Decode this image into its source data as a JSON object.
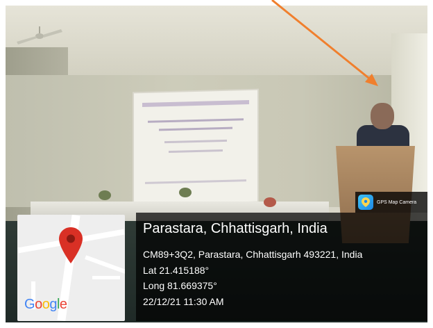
{
  "gps_camera": {
    "app_name": "GPS Map Camera",
    "location_title": "Parastara, Chhattisgarh, India",
    "address": "CM89+3Q2, Parastara, Chhattisgarh 493221, India",
    "latitude": "Lat 21.415188°",
    "longitude": "Long 81.669375°",
    "timestamp": "22/12/21 11:30 AM"
  },
  "map": {
    "brand": "Google",
    "brand_letters": [
      "G",
      "o",
      "o",
      "g",
      "l",
      "e"
    ],
    "brand_colors": [
      "#4285F4",
      "#EA4335",
      "#FBBC05",
      "#4285F4",
      "#34A853",
      "#EA4335"
    ],
    "pin_color": "#D93025"
  },
  "annotation": {
    "arrow_color": "#F07F2D"
  },
  "photo": {
    "icons": [
      "ceiling-fan-icon",
      "projector-screen",
      "podium",
      "speaker-person"
    ]
  }
}
